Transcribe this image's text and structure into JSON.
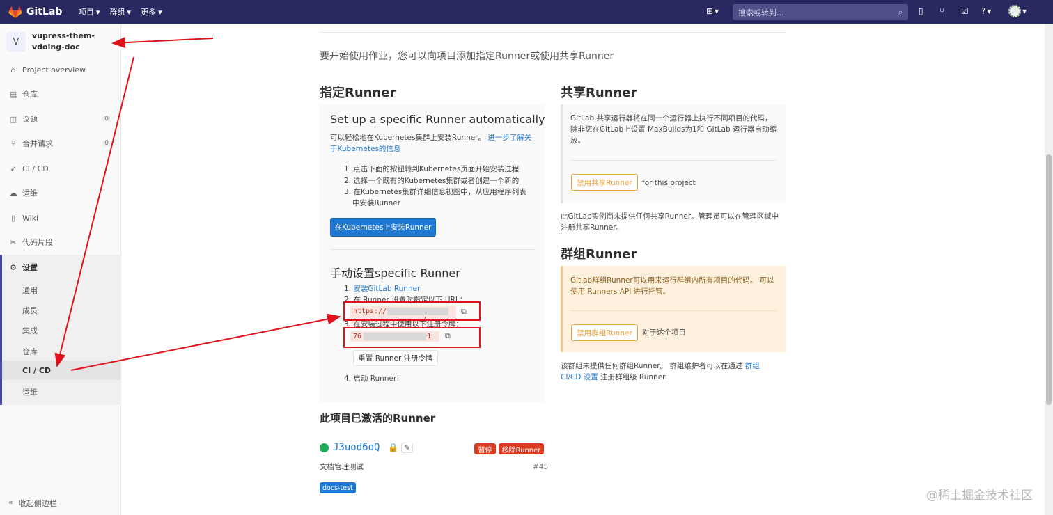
{
  "topnav": {
    "brand": "GitLab",
    "menu": [
      "项目",
      "群组",
      "更多"
    ],
    "search_placeholder": "搜索或转到..."
  },
  "sidebar": {
    "project_initial": "V",
    "project_name": "vupress-them-vdoing-doc",
    "items": [
      {
        "label": "Project overview",
        "icon": "home-icon"
      },
      {
        "label": "仓库",
        "icon": "repo-icon"
      },
      {
        "label": "议题",
        "icon": "issues-icon",
        "count": "0"
      },
      {
        "label": "合并请求",
        "icon": "merge-request-icon",
        "count": "0"
      },
      {
        "label": "CI / CD",
        "icon": "rocket-icon"
      },
      {
        "label": "运维",
        "icon": "cloud-icon"
      },
      {
        "label": "Wiki",
        "icon": "book-icon"
      },
      {
        "label": "代码片段",
        "icon": "scissors-icon"
      }
    ],
    "settings_label": "设置",
    "settings_sub": [
      "通用",
      "成员",
      "集成",
      "仓库",
      "CI / CD",
      "运维"
    ],
    "collapse_label": "收起侧边栏"
  },
  "main": {
    "intro": "要开始使用作业，您可以向项目添加指定Runner或使用共享Runner",
    "specific": {
      "title": "指定Runner",
      "auto_title": "Set up a specific Runner automatically",
      "auto_desc": "可以轻松地在Kubernetes集群上安装Runner。",
      "auto_link": "进一步了解关于Kubernetes的信息",
      "steps": [
        "1. 点击下面的按钮转到Kubernetes页面开始安装过程",
        "2. 选择一个既有的Kubernetes集群或者创建一个新的",
        "3. 在Kubernetes集群详细信息视图中，从应用程序列表中安装Runner"
      ],
      "install_button": "在Kubernetes上安装Runner",
      "manual_title": "手动设置specific Runner",
      "manual_step1_prefix": "1. ",
      "manual_step1_link": "安装GitLab Runner",
      "manual_step2": "2. 在 Runner 设置时指定以下 URL：",
      "url_value_start": "https://",
      "url_value_end": "/",
      "manual_step3": "3. 在安装过程中使用以下注册令牌：",
      "token_start": "76",
      "token_end": "91",
      "reset_button": "重置 Runner 注册令牌",
      "manual_step4": "4. 启动 Runner!"
    },
    "shared": {
      "title": "共享Runner",
      "desc": "GitLab 共享运行器将在同一个运行器上执行不同项目的代码，除非您在GitLab上设置 MaxBuilds为1和 GitLab 运行器自动缩放。",
      "disable_button": "禁用共享Runner",
      "for_project": "for this project",
      "note": "此GitLab实例尚未提供任何共享Runner。管理员可以在管理区域中注册共享Runner。"
    },
    "group": {
      "title": "群组Runner",
      "desc": "Gitlab群组Runner可以用来运行群组内所有项目的代码。 可以使用 Runners API 进行托管。",
      "disable_button": "禁用群组Runner",
      "for_project": "对于这个项目",
      "note_prefix": "该群组未提供任何群组Runner。 群组维护者可以在通过 ",
      "note_link": "群组CI/CD 设置",
      "note_suffix": " 注册群组级 Runner"
    },
    "active": {
      "title": "此项目已激活的Runner",
      "runner_name": "J3uod6oQ",
      "pause_label": "暂停",
      "remove_label": "移除Runner",
      "description": "文档管理测试",
      "runner_id": "#45",
      "tag": "docs-test"
    }
  },
  "watermark": "@稀土掘金技术社区",
  "colors": {
    "nav_bg": "#292961",
    "link": "#1f78d1",
    "annotation_red": "#e0131c",
    "warning_orange": "#e9a23b"
  }
}
